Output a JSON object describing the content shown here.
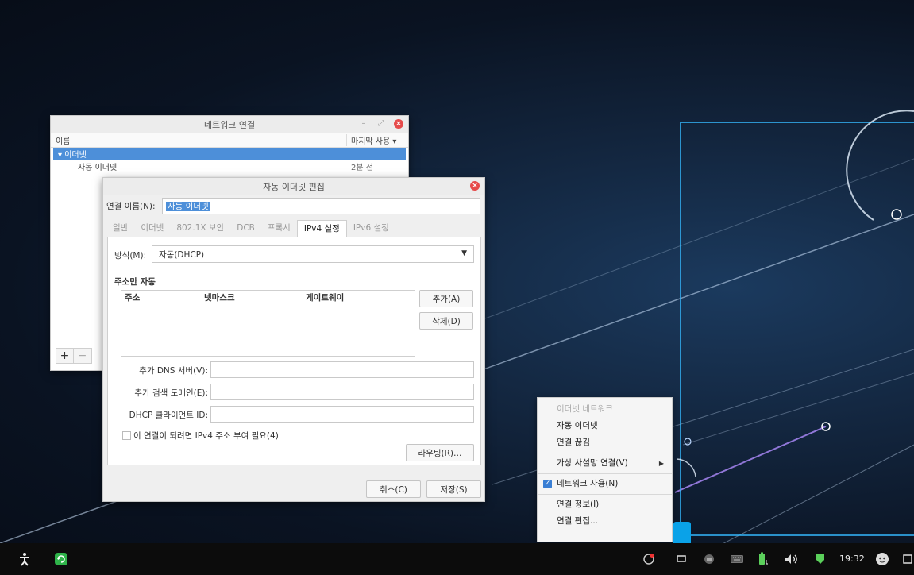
{
  "net_window": {
    "title": "네트워크 연결",
    "col_name": "이름",
    "col_last_used": "마지막 사용 ▾",
    "group": "▾ 이더넷",
    "item_name": "자동 이더넷",
    "item_time": "2분 전",
    "add_label": "+",
    "remove_label": "−"
  },
  "edit_window": {
    "title": "자동 이더넷 편집",
    "conn_name_label": "연결 이름(N):",
    "conn_name_value": "자동 이더넷",
    "tabs": [
      "일반",
      "이더넷",
      "802.1X 보안",
      "DCB",
      "프록시",
      "IPv4 설정",
      "IPv6 설정"
    ],
    "active_tab": "IPv4 설정",
    "method_label": "방식(M):",
    "method_value": "자동(DHCP)",
    "addresses_heading": "주소만 자동",
    "col_address": "주소",
    "col_netmask": "넷마스크",
    "col_gateway": "게이트웨이",
    "add_button": "추가(A)",
    "delete_button": "삭제(D)",
    "dns_label": "추가 DNS 서버(V):",
    "search_domain_label": "추가 검색 도메인(E):",
    "dhcp_id_label": "DHCP 클라이언트 ID:",
    "require_ipv4_label": "이 연결이 되려면 IPv4 주소 부여 필요(4)",
    "routes_button": "라우팅(R)…",
    "cancel_button": "취소(C)",
    "save_button": "저장(S)"
  },
  "tray_menu": {
    "header": "이더넷 네트워크",
    "item_auto_ethernet": "자동 이더넷",
    "item_disconnect": "연결 끊김",
    "item_vpn": "가상 사설망 연결(V)",
    "item_enable_networking": "네트워크 사용(N)",
    "item_connection_info": "연결 정보(I)",
    "item_edit_connections": "연결 편집..."
  },
  "taskbar": {
    "clock": "19:32"
  },
  "colors": {
    "selection_blue": "#4d8fd9",
    "close_red": "#e64b4b",
    "tray_highlight": "#0aa2e8",
    "taskbar": "#0c0c0c"
  }
}
